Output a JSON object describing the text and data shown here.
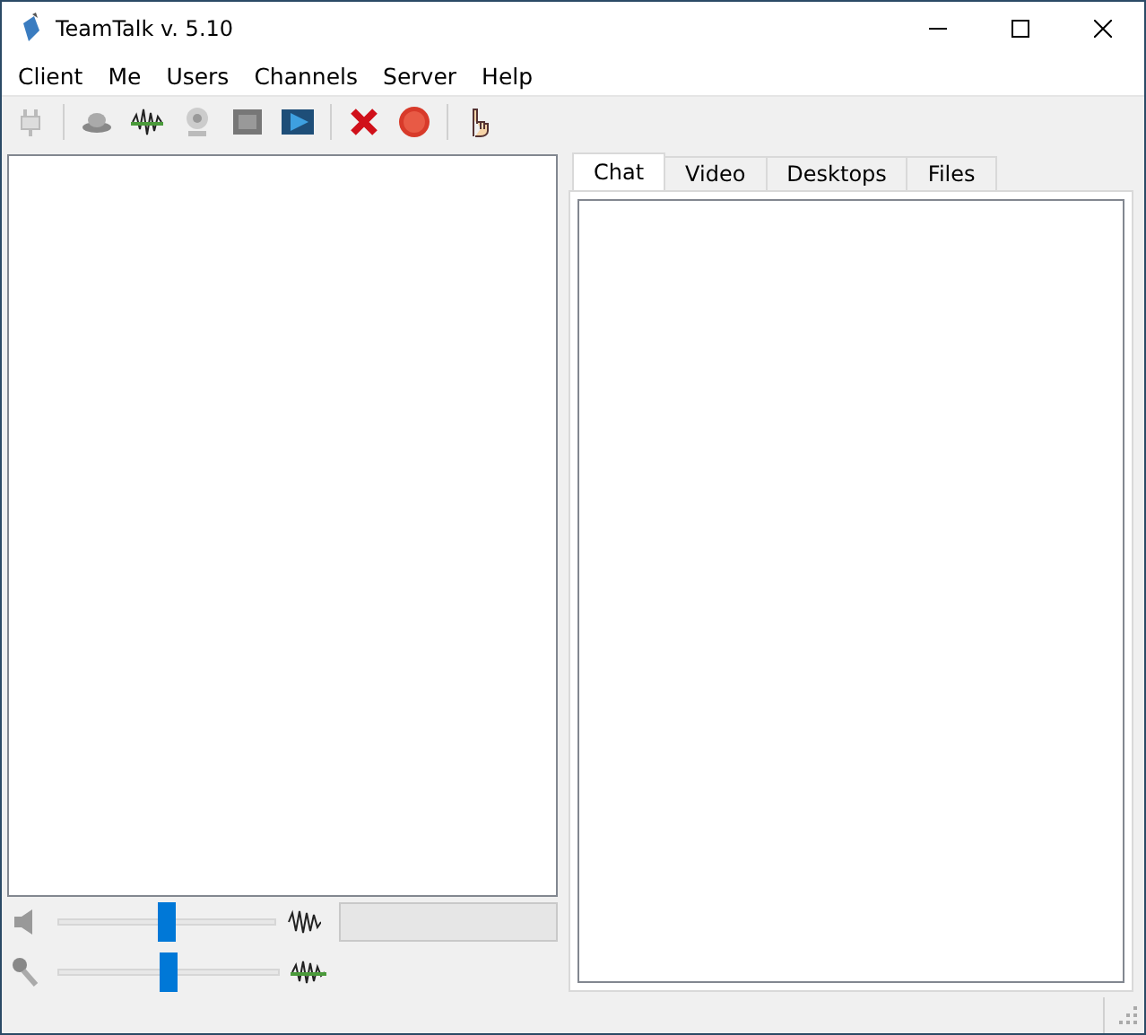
{
  "window": {
    "title": "TeamTalk v. 5.10"
  },
  "menu": [
    "Client",
    "Me",
    "Users",
    "Channels",
    "Server",
    "Help"
  ],
  "tabs": [
    {
      "label": "Chat",
      "selected": true
    },
    {
      "label": "Video",
      "selected": false
    },
    {
      "label": "Desktops",
      "selected": false
    },
    {
      "label": "Files",
      "selected": false
    }
  ],
  "volume": {
    "level": 0.5
  },
  "microphone": {
    "level": 0.5
  }
}
